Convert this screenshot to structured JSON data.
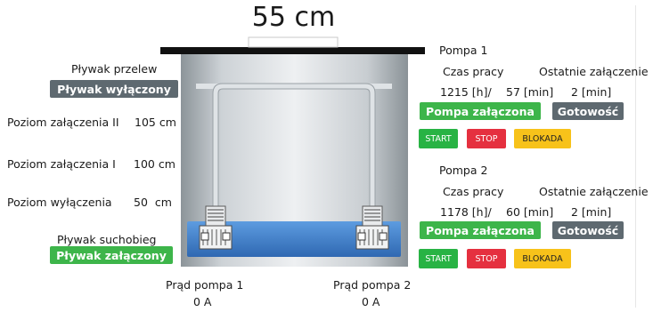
{
  "tank": {
    "level_display": "55 cm",
    "float_overflow_label": "Pływak przelew",
    "float_overflow_status": "Pływak wyłączony",
    "dry_run_float_label": "Pływak suchobieg",
    "dry_run_float_status": "Pływak załączony",
    "level_on_2_label": "Poziom załączenia II",
    "level_on_2_value": "105 cm",
    "level_on_1_label": "Poziom załączenia I",
    "level_on_1_value": "100 cm",
    "level_off_label": "Poziom wyłączenia",
    "level_off_value": "50  cm"
  },
  "currents": {
    "pump1_label": "Prąd pompa 1",
    "pump1_value": "0 A",
    "pump2_label": "Prąd pompa 2",
    "pump2_value": "0 A"
  },
  "pump1": {
    "title": "Pompa 1",
    "work_time_label": "Czas pracy",
    "last_on_label": "Ostatnie załączenie",
    "hours": "1215 [h]/",
    "minutes": "57 [min]",
    "last_on_value": "2 [min]",
    "state": "Pompa załączona",
    "ready": "Gotowość",
    "start_label": "START",
    "stop_label": "STOP",
    "block_label": "BLOKADA"
  },
  "pump2": {
    "title": "Pompa 2",
    "work_time_label": "Czas pracy",
    "last_on_label": "Ostatnie załączenie",
    "hours": "1178 [h]/",
    "minutes": "60 [min]",
    "last_on_value": "2 [min]",
    "state": "Pompa załączona",
    "ready": "Gotowość",
    "start_label": "START",
    "stop_label": "STOP",
    "block_label": "BLOKADA"
  },
  "colors": {
    "status_green": "#3db54a",
    "status_gray": "#5e6970",
    "start": "#28b344",
    "stop": "#e5303f",
    "block": "#f7c21a",
    "water": "#3f7fc8"
  }
}
